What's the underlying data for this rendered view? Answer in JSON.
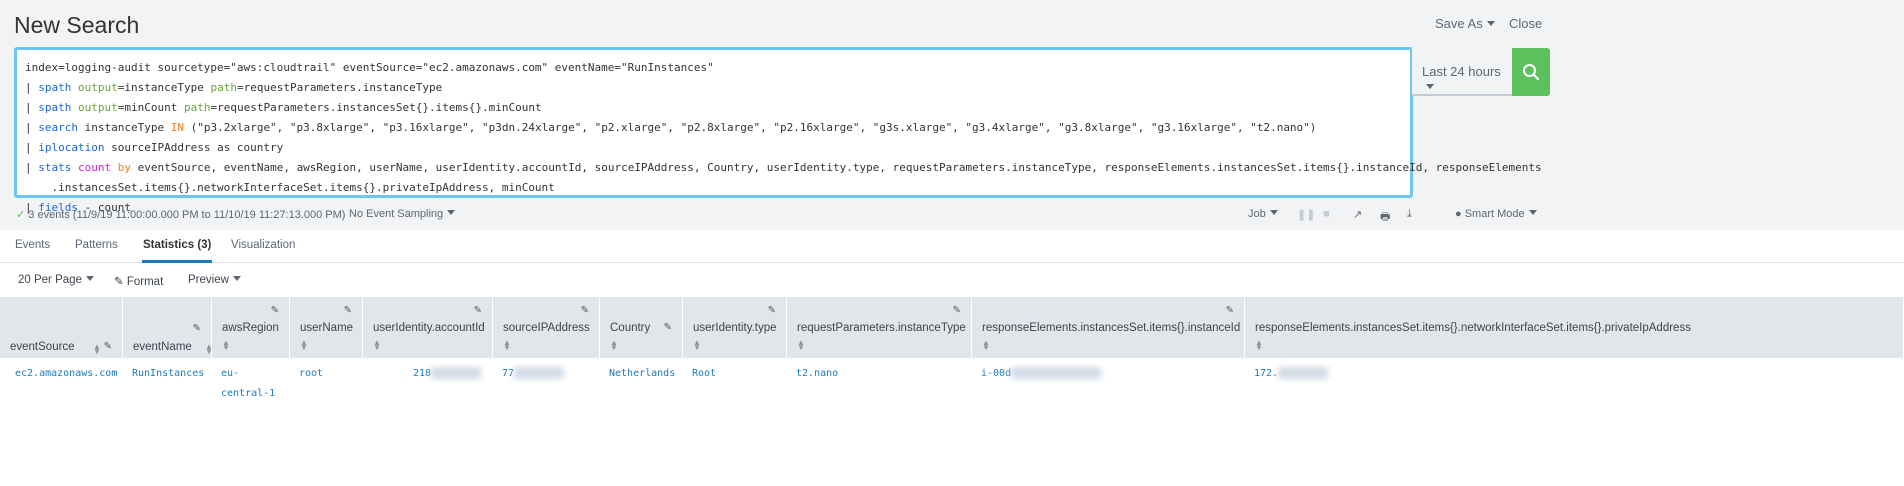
{
  "header": {
    "title": "New Search",
    "save_as": "Save As",
    "close": "Close"
  },
  "query": {
    "lines": [
      [
        {
          "t": "index=logging-audit sourcetype=\"aws:cloudtrail\" eventSource=\"ec2.amazonaws.com\" eventName=\"RunInstances\"",
          "c": ""
        }
      ],
      [
        {
          "t": "| ",
          "c": ""
        },
        {
          "t": "spath",
          "c": "kw"
        },
        {
          "t": " ",
          "c": ""
        },
        {
          "t": "output",
          "c": "arg"
        },
        {
          "t": "=instanceType ",
          "c": ""
        },
        {
          "t": "path",
          "c": "arg"
        },
        {
          "t": "=requestParameters.instanceType",
          "c": ""
        }
      ],
      [
        {
          "t": "| ",
          "c": ""
        },
        {
          "t": "spath",
          "c": "kw"
        },
        {
          "t": " ",
          "c": ""
        },
        {
          "t": "output",
          "c": "arg"
        },
        {
          "t": "=minCount ",
          "c": ""
        },
        {
          "t": "path",
          "c": "arg"
        },
        {
          "t": "=requestParameters.instancesSet{}.items{}.minCount",
          "c": ""
        }
      ],
      [
        {
          "t": "| ",
          "c": ""
        },
        {
          "t": "search",
          "c": "kw"
        },
        {
          "t": " instanceType ",
          "c": ""
        },
        {
          "t": "IN",
          "c": "op"
        },
        {
          "t": " (\"p3.2xlarge\", \"p3.8xlarge\", \"p3.16xlarge\", \"p3dn.24xlarge\", \"p2.xlarge\", \"p2.8xlarge\", \"p2.16xlarge\", \"g3s.xlarge\", \"g3.4xlarge\", \"g3.8xlarge\", \"g3.16xlarge\", \"t2.nano\")",
          "c": ""
        }
      ],
      [
        {
          "t": "| ",
          "c": ""
        },
        {
          "t": "iplocation",
          "c": "kw"
        },
        {
          "t": " sourceIPAddress as country",
          "c": ""
        }
      ],
      [
        {
          "t": "| ",
          "c": ""
        },
        {
          "t": "stats",
          "c": "kw"
        },
        {
          "t": " ",
          "c": ""
        },
        {
          "t": "count",
          "c": "fn"
        },
        {
          "t": " ",
          "c": ""
        },
        {
          "t": "by",
          "c": "op"
        },
        {
          "t": " eventSource, eventName, awsRegion, userName, userIdentity.accountId, sourceIPAddress, Country, userIdentity.type, requestParameters.instanceType, responseElements.instancesSet.items{}.instanceId, responseElements",
          "c": ""
        }
      ],
      [
        {
          "t": "    .instancesSet.items{}.networkInterfaceSet.items{}.privateIpAddress, minCount",
          "c": ""
        }
      ],
      [
        {
          "t": "| ",
          "c": ""
        },
        {
          "t": "fields",
          "c": "kw"
        },
        {
          "t": " - count",
          "c": ""
        }
      ]
    ]
  },
  "time_picker": "Last 24 hours",
  "status": {
    "events": "3 events (11/9/19 11:00:00.000 PM to 11/10/19 11:27:13.000 PM)",
    "sampling": "No Event Sampling",
    "job": "Job",
    "mode": "Smart Mode"
  },
  "tabs": [
    {
      "label": "Events"
    },
    {
      "label": "Patterns"
    },
    {
      "label": "Statistics (3)"
    },
    {
      "label": "Visualization"
    }
  ],
  "toolbar": {
    "per_page": "20 Per Page",
    "format": "Format",
    "preview": "Preview"
  },
  "table": {
    "columns": [
      "eventSource",
      "eventName",
      "awsRegion",
      "userName",
      "userIdentity.accountId",
      "sourceIPAddress",
      "Country",
      "userIdentity.type",
      "requestParameters.instanceType",
      "responseElements.instancesSet.items{}.instanceId",
      "responseElements.instancesSet.items{}.networkInterfaceSet.items{}.privateIpAddress"
    ],
    "rows": [
      [
        "ec2.amazonaws.com",
        "RunInstances",
        "eu-\ncentral-1",
        "root",
        "218",
        "77",
        "Netherlands",
        "Root",
        "t2.nano",
        "i-00d",
        "172."
      ]
    ]
  },
  "colors": {
    "accent": "#1a7bbf",
    "search_button": "#5cc05c",
    "query_border": "#6dc5f2"
  }
}
